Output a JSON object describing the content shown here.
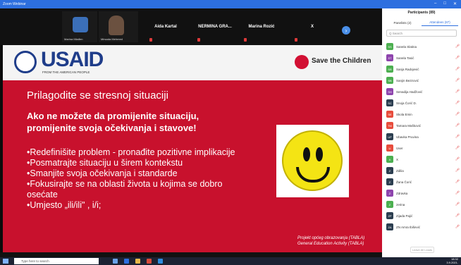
{
  "window": {
    "title": "Zoom Webinar"
  },
  "video_strip": {
    "tiles": [
      {
        "name": "Marina Mlađen"
      },
      {
        "name": "Mirsada Mehmed"
      }
    ],
    "name_tiles": [
      "Aida Kartal",
      "NERMINA GRA...",
      "Marina Rozić",
      "X"
    ],
    "next_icon": "chevron-right-icon"
  },
  "slide": {
    "usaid_logo": "USAID",
    "usaid_tagline": "FROM THE AMERICAN PEOPLE",
    "stc_logo": "Save the Children",
    "title": "Prilagodite se stresnoj situaciji",
    "subtitle_1": "Ako ne možete da promijenite situaciju,",
    "subtitle_2": "promijenite svoja očekivanja i stavove!",
    "bullets": [
      "•Redefinišite problem - pronađite pozitivne implikacije",
      "•Posmatrajte situaciju u širem kontekstu",
      "•Smanjite svoja očekivanja i standarde",
      "•Fokusirajte se na  oblasti života u kojima se dobro",
      "osećate",
      "•Umjesto „ili/ili\" , i/i;"
    ],
    "footer_line1": "Projekt općeg obrazovanja (TABLA)",
    "footer_line2": "General Education Activity (TABLA)",
    "accent_color": "#c8112d"
  },
  "panel": {
    "title": "Participants (89)",
    "tabs": [
      "Panelists (2)",
      "Attendees (87)"
    ],
    "search_placeholder": "Q Search",
    "participants": [
      {
        "initials": "SS",
        "name": "Sanela Slatina",
        "color": "#4caf50"
      },
      {
        "initials": "ST",
        "name": "Sanela Tasić",
        "color": "#8e44ad"
      },
      {
        "initials": "SR",
        "name": "Sanja Radojević",
        "color": "#4caf50"
      },
      {
        "initials": "SB",
        "name": "Sanjin Bezirović",
        "color": "#4caf50"
      },
      {
        "initials": "SH",
        "name": "Senadija Hadžović",
        "color": "#8e44ad"
      },
      {
        "initials": "SC",
        "name": "Snoja Čorić D.",
        "color": "#2c3e50"
      },
      {
        "initials": "SE",
        "name": "Skola Emin",
        "color": "#e74c3c"
      },
      {
        "initials": "TM",
        "name": "Tamara Mašković",
        "color": "#e74c3c"
      },
      {
        "initials": "UP",
        "name": "Ubavka Pruvina",
        "color": "#2c3e50"
      },
      {
        "initials": "U",
        "name": "User",
        "color": "#e74c3c"
      },
      {
        "initials": "X",
        "name": "X",
        "color": "#4caf50"
      },
      {
        "initials": "Z",
        "name": "Zdilia",
        "color": "#2c3e50"
      },
      {
        "initials": "Z",
        "name": "Žana Čorić",
        "color": "#2c3e50"
      },
      {
        "initials": "Z",
        "name": "Zdravka",
        "color": "#8e44ad"
      },
      {
        "initials": "Z",
        "name": "zerina",
        "color": "#4caf50"
      },
      {
        "initials": "ZP",
        "name": "Zijada Pajić",
        "color": "#2c3e50"
      },
      {
        "initials": "ZA",
        "name": "ZN Amra Ibišević",
        "color": "#2c3e50"
      }
    ],
    "leave_label": "Leave All Leads"
  },
  "taskbar": {
    "search_placeholder": "Type here to search",
    "time": "18:32",
    "date": "3.9.2021."
  }
}
